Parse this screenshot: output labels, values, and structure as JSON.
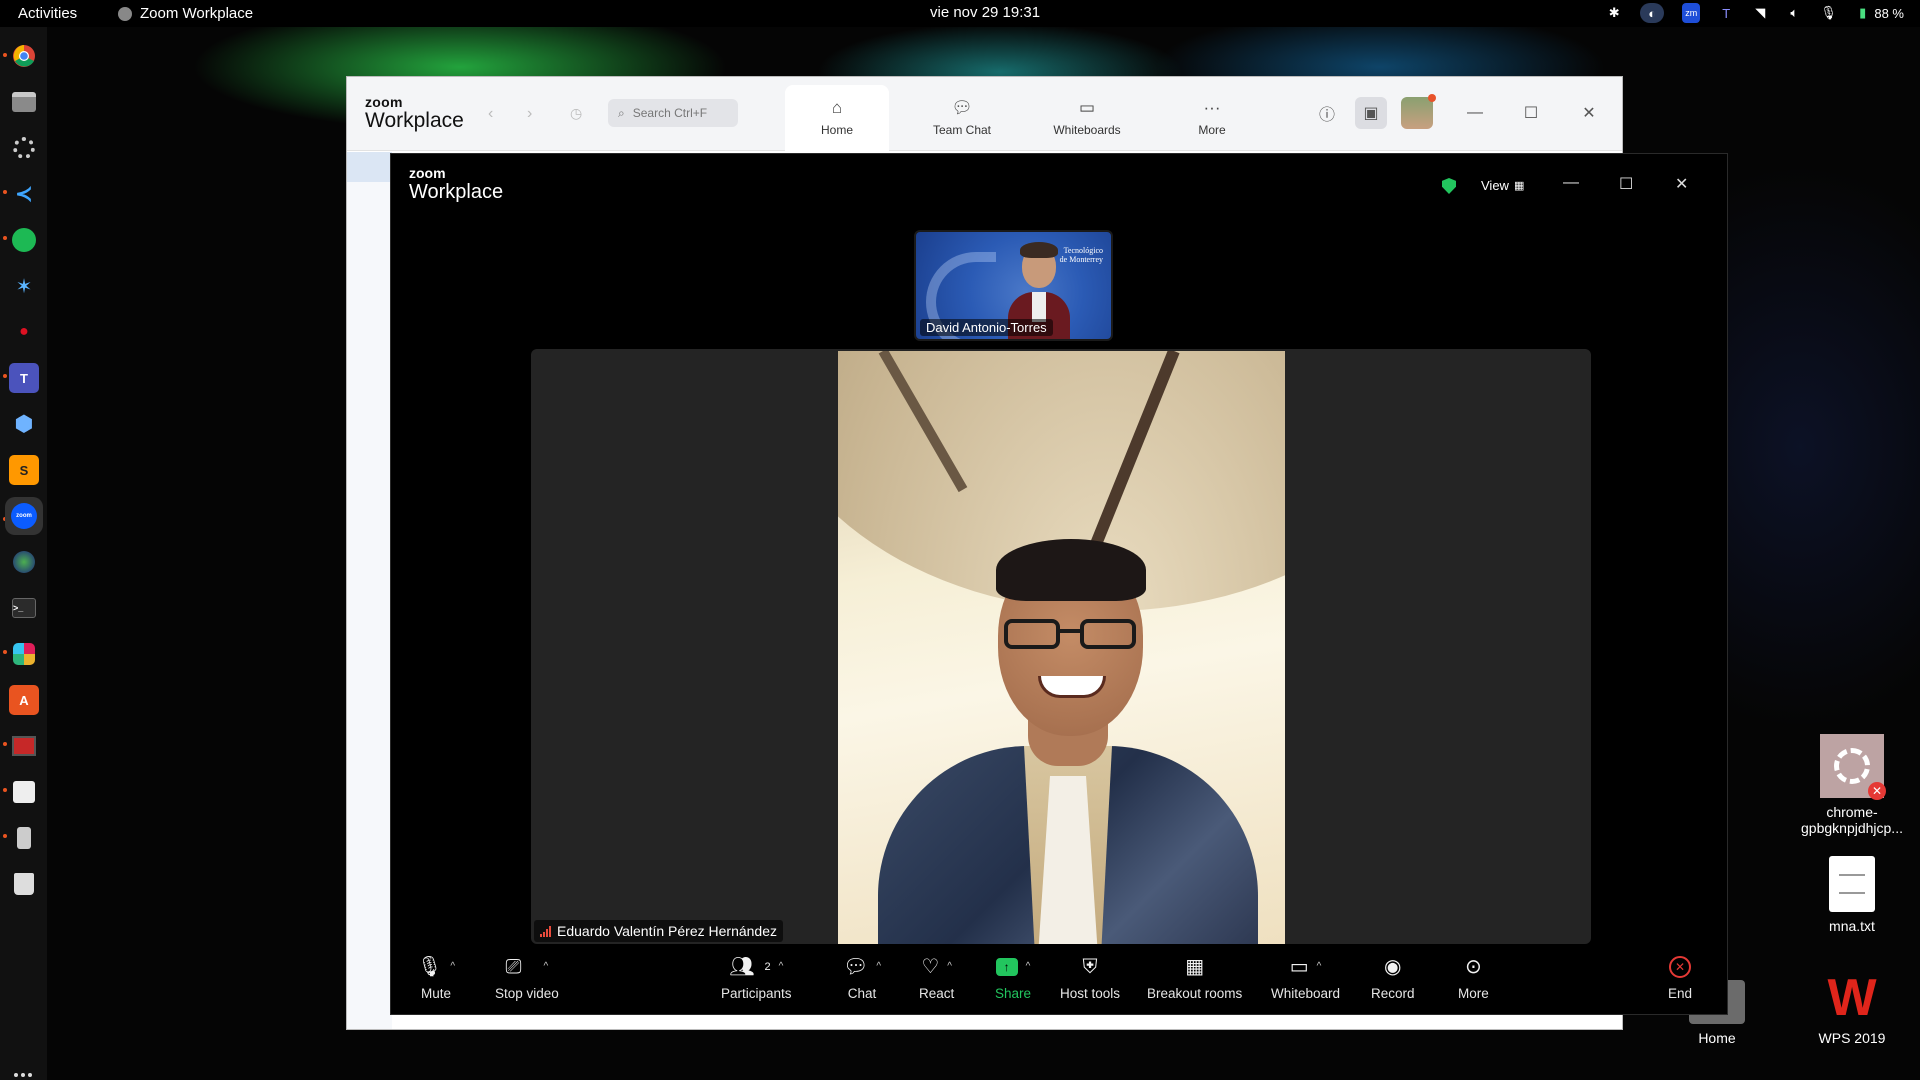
{
  "topbar": {
    "activities": "Activities",
    "app_name": "Zoom Workplace",
    "datetime": "vie nov 29  19:31",
    "battery": "88 %"
  },
  "dock": {
    "items": [
      "chrome-icon",
      "files-icon",
      "settings-icon",
      "vscode-icon",
      "spotify-icon",
      "app-icon",
      "app-icon",
      "teams-icon",
      "virtualbox-icon",
      "sublime-icon",
      "zoom-icon",
      "app-icon",
      "terminal-icon",
      "slack-icon",
      "app-store-icon",
      "app-icon",
      "app-icon",
      "app-icon",
      "trash-icon"
    ]
  },
  "desktop": {
    "icons": [
      {
        "label": "chrome-\ngpbgknpjdhjcp..."
      },
      {
        "label": "mna.txt"
      },
      {
        "label": "Home"
      },
      {
        "label": "WPS 2019"
      }
    ]
  },
  "main_window": {
    "brand_top": "zoom",
    "brand_bottom": "Workplace",
    "search_placeholder": "Search Ctrl+F",
    "tabs": [
      {
        "label": "Home",
        "active": true
      },
      {
        "label": "Team Chat"
      },
      {
        "label": "Whiteboards"
      },
      {
        "label": "More"
      }
    ]
  },
  "meeting": {
    "brand_top": "zoom",
    "brand_bottom": "Workplace",
    "view_label": "View",
    "thumbnail_name": "David Antonio-Torres",
    "thumbnail_logo": "Tecnológico\nde Monterrey",
    "speaker_name": "Eduardo Valentín Pérez Hernández",
    "toolbar": {
      "mute": "Mute",
      "stop_video": "Stop video",
      "participants": "Participants",
      "participants_count": "2",
      "chat": "Chat",
      "react": "React",
      "share": "Share",
      "host_tools": "Host tools",
      "breakout_rooms": "Breakout rooms",
      "whiteboard": "Whiteboard",
      "record": "Record",
      "more": "More",
      "end": "End"
    }
  },
  "colors": {
    "share_green": "#22c55e",
    "end_red": "#e53935",
    "ubuntu_orange": "#e95420",
    "zoom_blue": "#0b5cff"
  }
}
